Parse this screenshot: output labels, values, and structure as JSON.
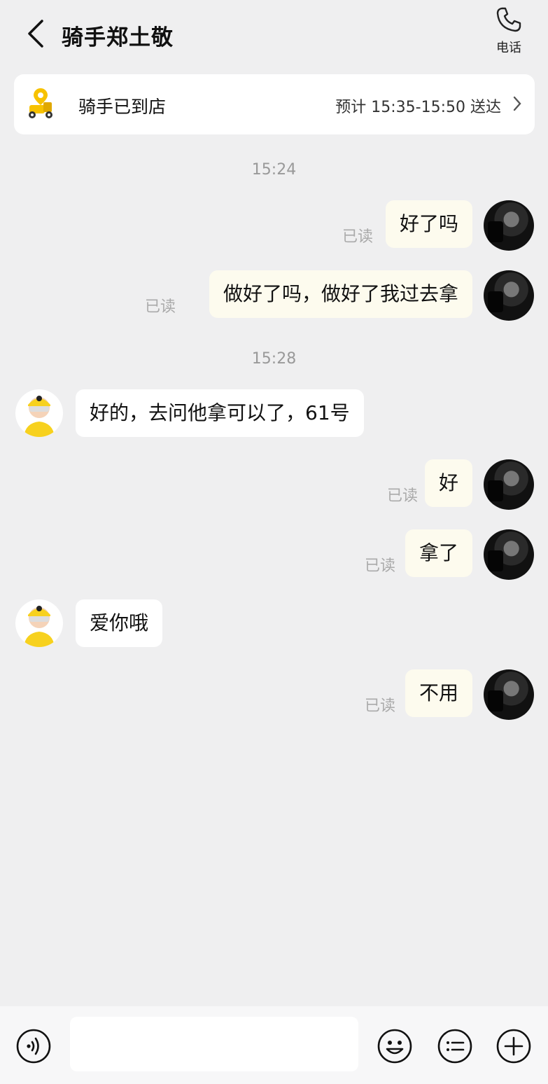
{
  "header": {
    "title": "骑手郑土敬",
    "phone_label": "电话"
  },
  "status": {
    "text": "骑手已到店",
    "eta": "预计 15:35-15:50 送达"
  },
  "times": [
    "15:24",
    "15:28"
  ],
  "messages": [
    {
      "side": "me",
      "text": "好了吗",
      "read": "已读"
    },
    {
      "side": "me",
      "text": "做好了吗，做好了我过去拿",
      "read": "已读"
    },
    {
      "side": "them",
      "text": "好的，去问他拿可以了，61号"
    },
    {
      "side": "me",
      "text": "好",
      "read": "已读"
    },
    {
      "side": "me",
      "text": "拿了",
      "read": "已读"
    },
    {
      "side": "them",
      "text": "爱你哦"
    },
    {
      "side": "me",
      "text": "不用",
      "read": "已读"
    }
  ],
  "input": {
    "placeholder": ""
  },
  "colors": {
    "my_bubble": "#fdfbee",
    "their_bubble": "#ffffff",
    "background": "#efeff0",
    "accent": "#f7c200"
  },
  "icons": [
    "back-icon",
    "phone-icon",
    "rider-scooter-icon",
    "chevron-right-icon",
    "voice-icon",
    "emoji-icon",
    "quick-reply-icon",
    "plus-icon"
  ]
}
